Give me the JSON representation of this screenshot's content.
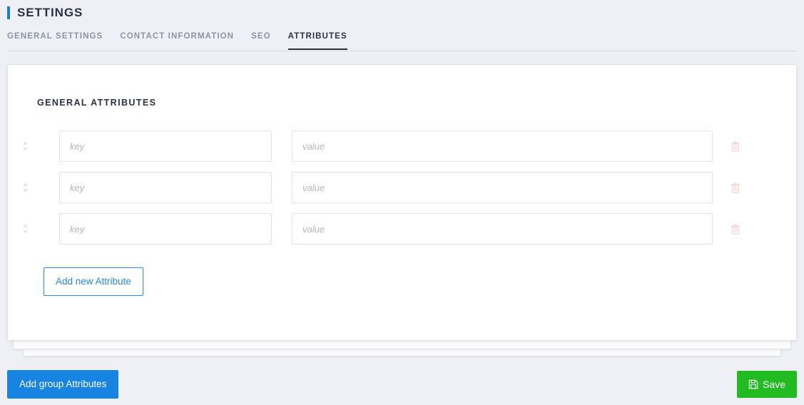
{
  "header": {
    "title": "SETTINGS",
    "accent_color": "#1a7fc4"
  },
  "tabs": [
    {
      "label": "GENERAL SETTINGS",
      "active": false
    },
    {
      "label": "CONTACT INFORMATION",
      "active": false
    },
    {
      "label": "SEO",
      "active": false
    },
    {
      "label": "ATTRIBUTES",
      "active": true
    }
  ],
  "card": {
    "section_title": "GENERAL ATTRIBUTES",
    "rows": [
      {
        "key_value": "",
        "key_placeholder": "key",
        "value_value": "",
        "value_placeholder": "value"
      },
      {
        "key_value": "",
        "key_placeholder": "key",
        "value_value": "",
        "value_placeholder": "value"
      },
      {
        "key_value": "",
        "key_placeholder": "key",
        "value_value": "",
        "value_placeholder": "value"
      }
    ],
    "add_attribute_label": "Add new Attribute",
    "add_attribute_color": "#2b87e3",
    "delete_icon_color": "#f6d9d9",
    "drag_icon_color": "#dfe2ea"
  },
  "footer": {
    "add_group_label": "Add group Attributes",
    "add_group_color": "#1684e0",
    "save_label": "Save",
    "save_color": "#22bb22"
  }
}
